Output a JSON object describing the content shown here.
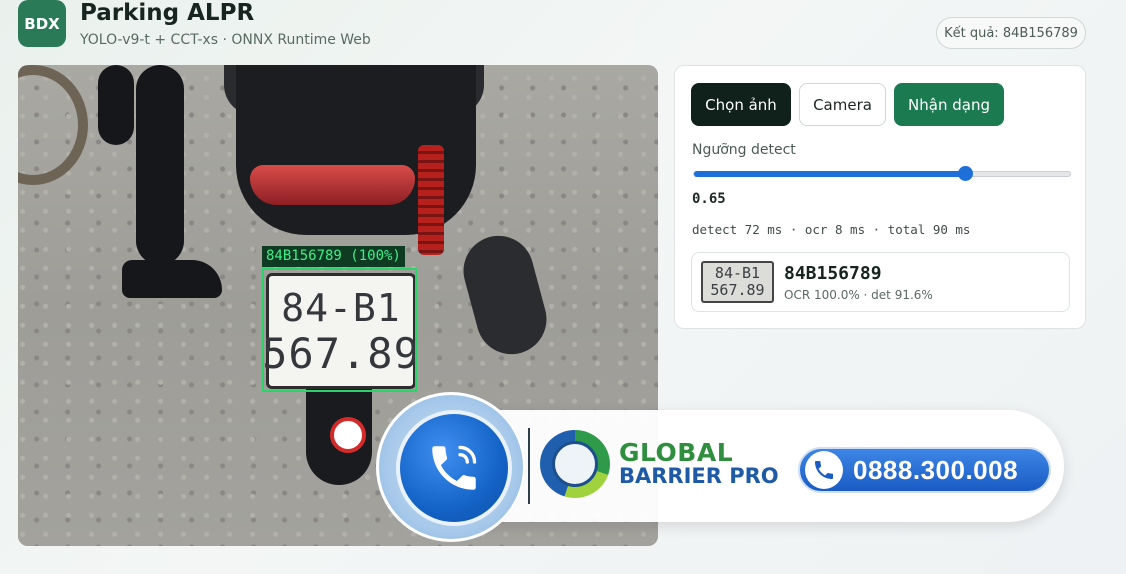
{
  "header": {
    "logo_text": "BDX",
    "title": "Parking ALPR",
    "subtitle": "YOLO-v9-t + CCT-xs · ONNX Runtime Web",
    "result_pill": "Kết quả: 84B156789"
  },
  "image_panel": {
    "detection_label": "84B156789 (100%)",
    "plate_line_1": "84-B1",
    "plate_line_2": "567.89"
  },
  "controls": {
    "choose_button": "Chọn ảnh",
    "camera_button": "Camera",
    "recognize_button": "Nhận dạng",
    "threshold_label": "Ngưỡng detect",
    "threshold_value": "0.65",
    "threshold_fraction": 0.72,
    "timing": "detect 72 ms · ocr 8 ms · total 90 ms"
  },
  "result": {
    "thumb_line_1": "84-B1",
    "thumb_line_2": "567.89",
    "plate": "84B156789",
    "meta": "OCR 100.0% · det 91.6%"
  },
  "banner": {
    "brand_line_1": "GLOBAL",
    "brand_line_2": "BARRIER PRO",
    "hotline": "0888.300.008"
  },
  "colors": {
    "accent_green": "#1b7a50",
    "slider_blue": "#1f6fdb",
    "detection_green": "#2bd36a"
  }
}
